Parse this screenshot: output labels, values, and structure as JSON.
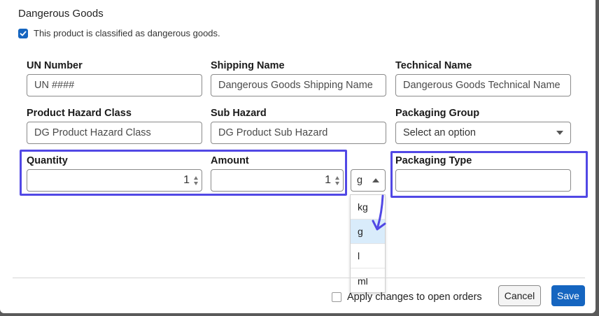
{
  "section": {
    "title": "Dangerous Goods",
    "dg_checkbox_label": "This product is classified as dangerous goods.",
    "dg_checked": true
  },
  "fields": {
    "un_number": {
      "label": "UN Number",
      "placeholder": "UN ####"
    },
    "shipping_name": {
      "label": "Shipping Name",
      "placeholder": "Dangerous Goods Shipping Name"
    },
    "technical_name": {
      "label": "Technical Name",
      "placeholder": "Dangerous Goods Technical Name"
    },
    "hazard_class": {
      "label": "Product Hazard Class",
      "placeholder": "DG Product Hazard Class"
    },
    "sub_hazard": {
      "label": "Sub Hazard",
      "placeholder": "DG Product Sub Hazard"
    },
    "packaging_group": {
      "label": "Packaging Group",
      "value": "Select an option"
    },
    "quantity": {
      "label": "Quantity",
      "value": "1"
    },
    "amount": {
      "label": "Amount",
      "value": "1"
    },
    "unit": {
      "value": "g",
      "options": [
        "kg",
        "g",
        "l",
        "ml"
      ],
      "selected": "g"
    },
    "packaging_type": {
      "label": "Packaging Type",
      "value": ""
    }
  },
  "footer": {
    "apply_label": "Apply changes to open orders",
    "cancel_label": "Cancel",
    "save_label": "Save"
  },
  "colors": {
    "accent": "#1565c0",
    "highlight": "#5148e5",
    "selected_option": "#d9ecfb"
  }
}
